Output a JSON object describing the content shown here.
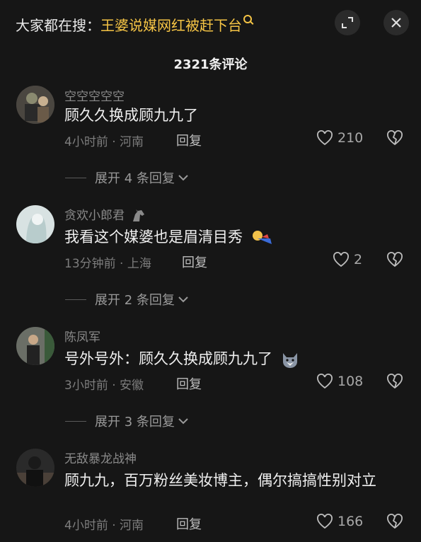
{
  "search": {
    "prefix": "大家都在搜：",
    "query": "王婆说媒网红被赶下台"
  },
  "header": {
    "title": "2321条评论"
  },
  "comments": [
    {
      "username": "空空空空空",
      "text": "顾久久换成顾九九了",
      "time": "4小时前",
      "location": "河南",
      "reply_label": "回复",
      "likes": "210",
      "expand_label": "展开 4 条回复"
    },
    {
      "username": "贪欢小郎君",
      "text": "我看这个媒婆也是眉清目秀",
      "time": "13分钟前",
      "location": "上海",
      "reply_label": "回复",
      "likes": "2",
      "expand_label": "展开 2 条回复"
    },
    {
      "username": "陈凤军",
      "text": "号外号外：顾久久换成顾九九了",
      "time": "3小时前",
      "location": "安徽",
      "reply_label": "回复",
      "likes": "108",
      "expand_label": "展开 3 条回复"
    },
    {
      "username": "无敌暴龙战神",
      "text": "顾九九，百万粉丝美妆博主，偶尔搞搞性别对立",
      "time": "4小时前",
      "location": "河南",
      "reply_label": "回复",
      "likes": "166"
    }
  ],
  "icons": {
    "expand": "fullscreen-icon",
    "close": "close-icon",
    "like": "heart-icon",
    "dislike": "broken-heart-icon",
    "chevron": "chevron-down-icon"
  },
  "colors": {
    "background": "#161616",
    "accent": "#f5c445"
  }
}
